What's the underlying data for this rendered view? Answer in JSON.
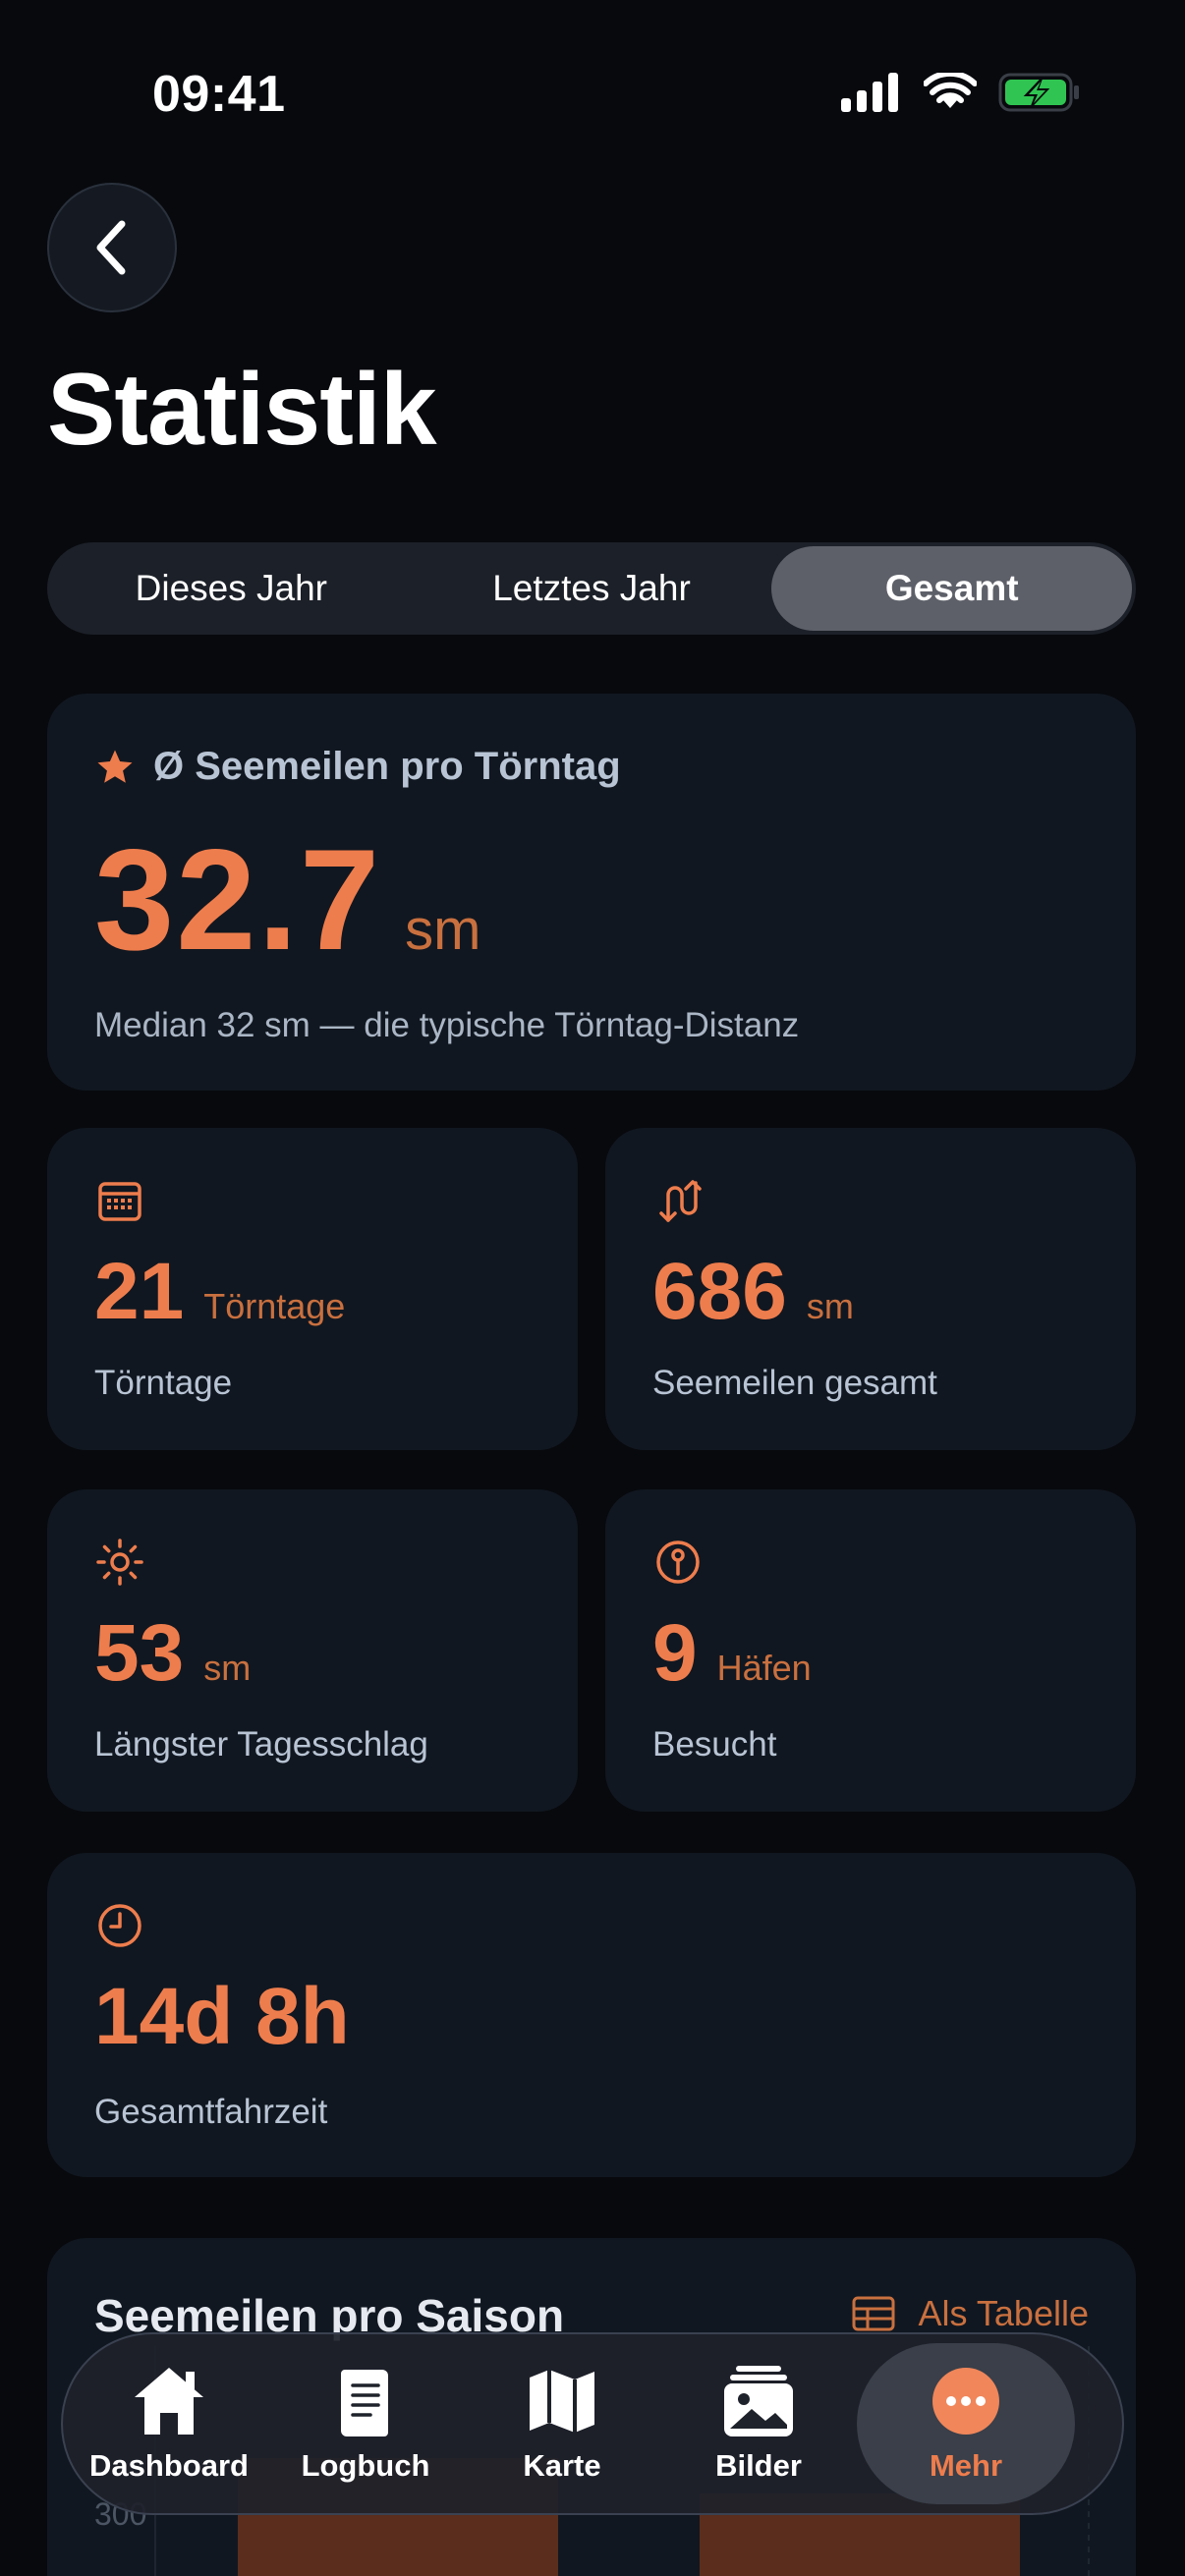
{
  "status_bar": {
    "time": "09:41"
  },
  "page": {
    "title": "Statistik"
  },
  "segments": [
    {
      "label": "Dieses Jahr",
      "active": false
    },
    {
      "label": "Letztes Jahr",
      "active": false
    },
    {
      "label": "Gesamt",
      "active": true
    }
  ],
  "hero": {
    "label": "Ø Seemeilen pro Törntag",
    "value": "32.7",
    "unit": "sm",
    "subtitle": "Median 32 sm — die typische Törntag-Distanz"
  },
  "stats": {
    "toerntage": {
      "value": "21",
      "unit": "Törntage",
      "label": "Törntage",
      "icon": "calendar-icon"
    },
    "seemeilen": {
      "value": "686",
      "unit": "sm",
      "label": "Seemeilen gesamt",
      "icon": "route-icon"
    },
    "laengster": {
      "value": "53",
      "unit": "sm",
      "label": "Längster Tagesschlag",
      "icon": "sun-icon"
    },
    "haefen": {
      "value": "9",
      "unit": "Häfen",
      "label": "Besucht",
      "icon": "pin-icon"
    },
    "fahrzeit": {
      "value": "14d 8h",
      "label": "Gesamtfahrzeit",
      "icon": "clock-icon"
    }
  },
  "chart": {
    "title": "Seemeilen pro Saison",
    "toggle_label": "Als Tabelle",
    "partial_tick": "300"
  },
  "tabs": [
    {
      "label": "Dashboard",
      "icon": "home-icon"
    },
    {
      "label": "Logbuch",
      "icon": "logbook-icon"
    },
    {
      "label": "Karte",
      "icon": "map-icon"
    },
    {
      "label": "Bilder",
      "icon": "photos-icon"
    },
    {
      "label": "Mehr",
      "icon": "more-icon",
      "active": true
    }
  ],
  "colors": {
    "accent": "#ee7d4d",
    "background": "#07090d",
    "card": "#111720"
  }
}
